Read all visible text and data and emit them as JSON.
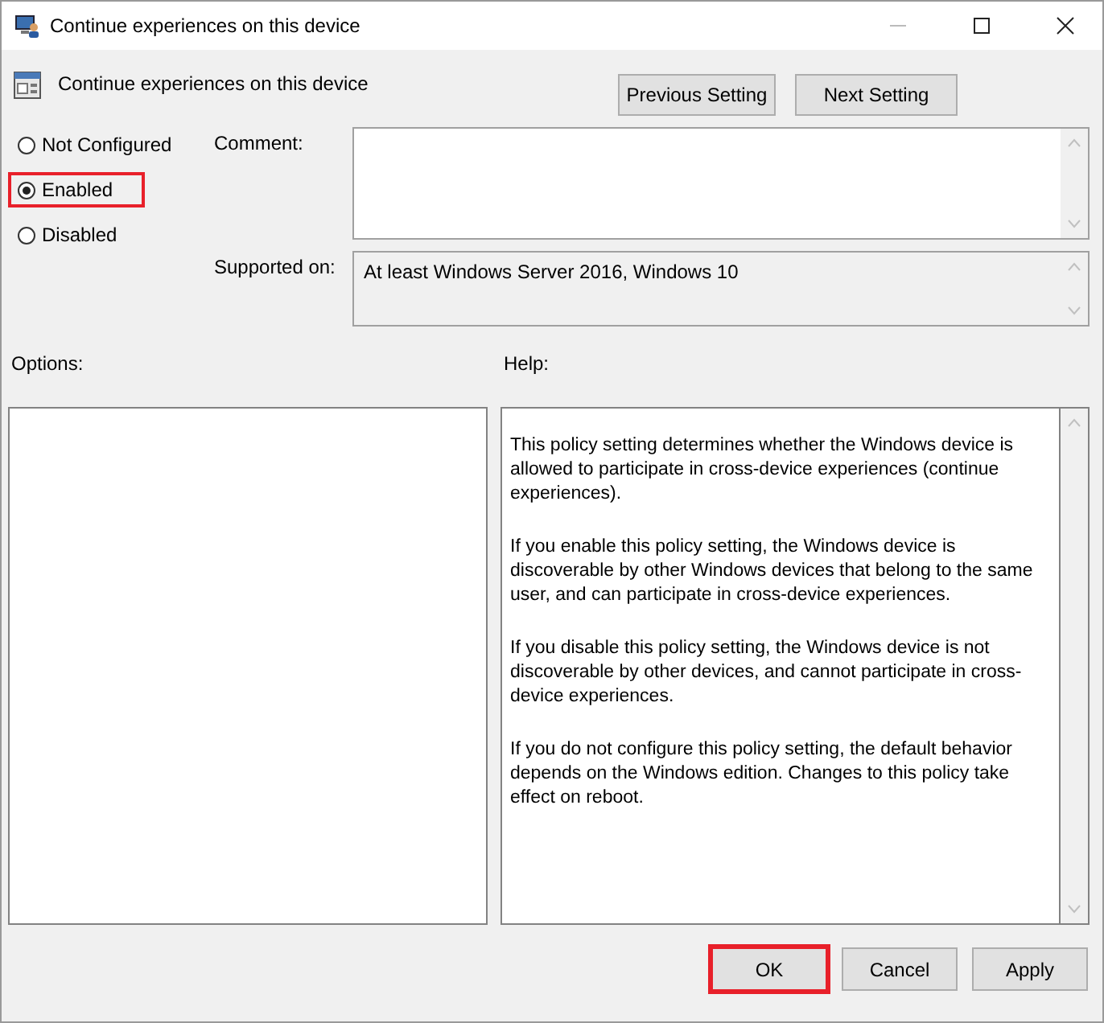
{
  "window": {
    "title": "Continue experiences on this device"
  },
  "header": {
    "title": "Continue experiences on this device"
  },
  "nav_buttons": [
    "Previous Setting",
    "Next Setting"
  ],
  "options": [
    {
      "label": "Not Configured",
      "selected": false,
      "highlighted": false
    },
    {
      "label": "Enabled",
      "selected": true,
      "highlighted": true
    },
    {
      "label": "Disabled",
      "selected": false,
      "highlighted": false
    }
  ],
  "comment": {
    "label": "Comment:"
  },
  "supported_on": {
    "label": "Supported on:",
    "value": "At least Windows Server 2016, Windows 10"
  },
  "options_panel": {
    "label": "Options:"
  },
  "help": {
    "label": "Help:",
    "paragraphs": [
      "This policy setting determines whether the Windows device is allowed to participate in cross-device experiences (continue experiences).",
      "If you enable this policy setting, the Windows device is discoverable by other Windows devices that belong to the same user, and can participate in cross-device experiences.",
      "If you disable this policy setting, the Windows device is not discoverable by other devices, and cannot participate in cross-device experiences.",
      "If you do not configure this policy setting, the default behavior depends on the Windows edition. Changes to this policy take effect on reboot."
    ]
  },
  "buttons": [
    {
      "label": "OK",
      "highlighted": true
    },
    {
      "label": "Cancel",
      "highlighted": false
    },
    {
      "label": "Apply",
      "highlighted": false
    }
  ]
}
